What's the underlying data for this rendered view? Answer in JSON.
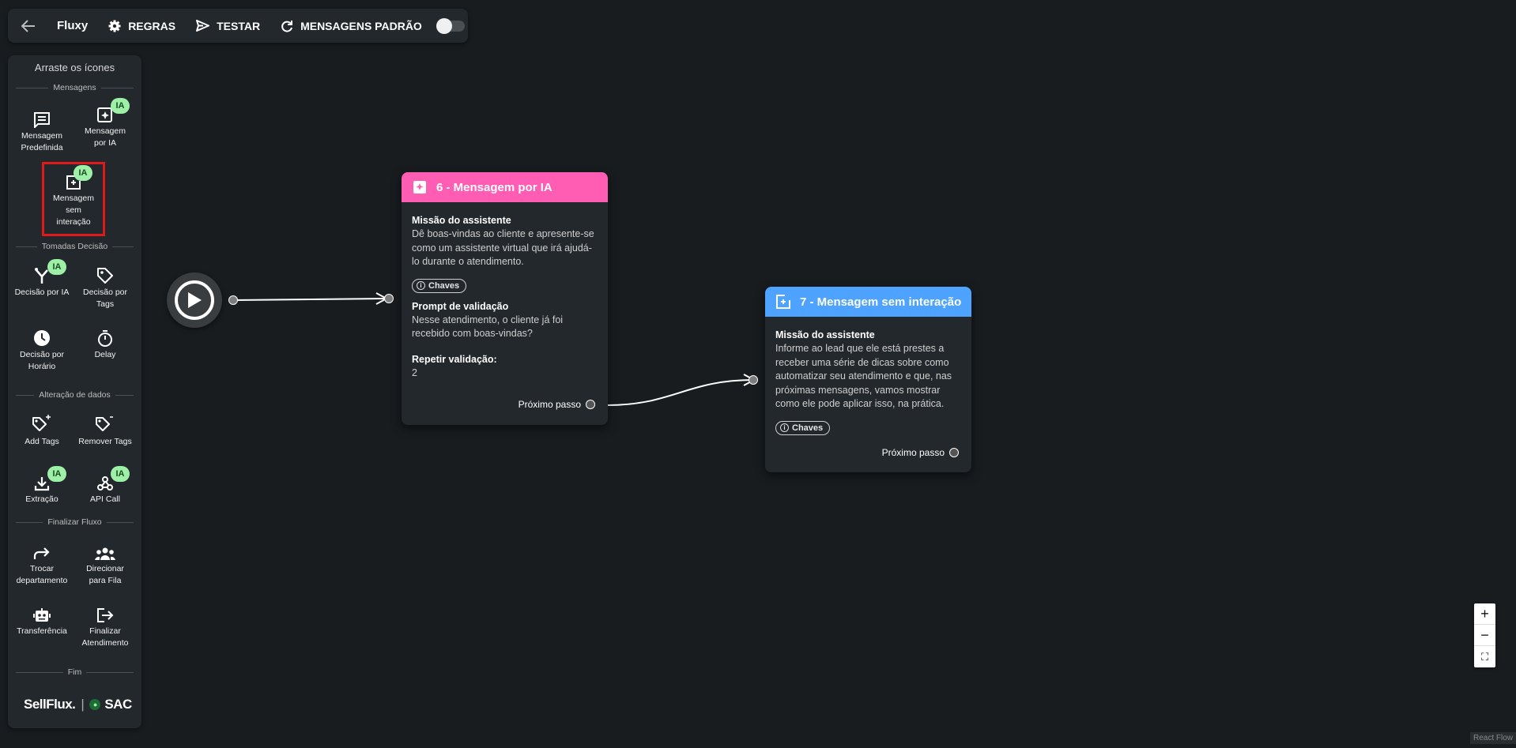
{
  "topbar": {
    "brand": "Fluxy",
    "rules_label": "REGRAS",
    "test_label": "TESTAR",
    "default_messages_label": "MENSAGENS PADRÃO",
    "default_messages_enabled": false
  },
  "sidebar": {
    "hint": "Arraste os ícones",
    "sections": {
      "messages": "Mensagens",
      "decisions": "Tomadas Decisão",
      "data": "Alteração de dados",
      "finish": "Finalizar Fluxo",
      "end": "Fim"
    },
    "tools": {
      "predefined": "Mensagem Predefinida",
      "ai_message": "Mensagem por IA",
      "no_interaction": "Mensagem sem interação",
      "ai_decision": "Decisão por IA",
      "tag_decision": "Decisão por Tags",
      "time_decision": "Decisão por Horário",
      "delay": "Delay",
      "add_tags": "Add Tags",
      "remove_tags": "Remover Tags",
      "extraction": "Extração",
      "api_call": "API Call",
      "change_department": "Trocar departamento",
      "queue": "Direcionar para Fila",
      "transfer": "Transferência",
      "finish_service": "Finalizar Atendimento"
    },
    "ai_badge": "IA",
    "logo_left": "SellFlux.",
    "logo_right": "SAC",
    "logo_sep": "|"
  },
  "nodes": {
    "ai_message": {
      "title": "6 - Mensagem por IA",
      "mission_label": "Missão do assistente",
      "mission_text": "Dê boas-vindas ao cliente e apresente-se como um assistente virtual que irá ajudá-lo durante o atendimento.",
      "keys_label": "Chaves",
      "prompt_label": "Prompt de validação",
      "prompt_text": "Nesse atendimento, o cliente já foi recebido com boas-vindas?",
      "repeat_label": "Repetir validação:",
      "repeat_value": "2",
      "next_label": "Próximo passo",
      "color": "#ff5cb3"
    },
    "no_interaction": {
      "title": "7 - Mensagem sem interação",
      "mission_label": "Missão do assistente",
      "mission_text": "Informe ao lead que ele está prestes a receber uma série de dicas sobre como automatizar seu atendimento e que, nas próximas mensagens, vamos mostrar como ele pode aplicar isso, na prática.",
      "keys_label": "Chaves",
      "next_label": "Próximo passo",
      "color": "#4da3ff"
    }
  },
  "zoom": {
    "in": "+",
    "out": "−",
    "fit": "⛶"
  },
  "attribution": "React Flow"
}
